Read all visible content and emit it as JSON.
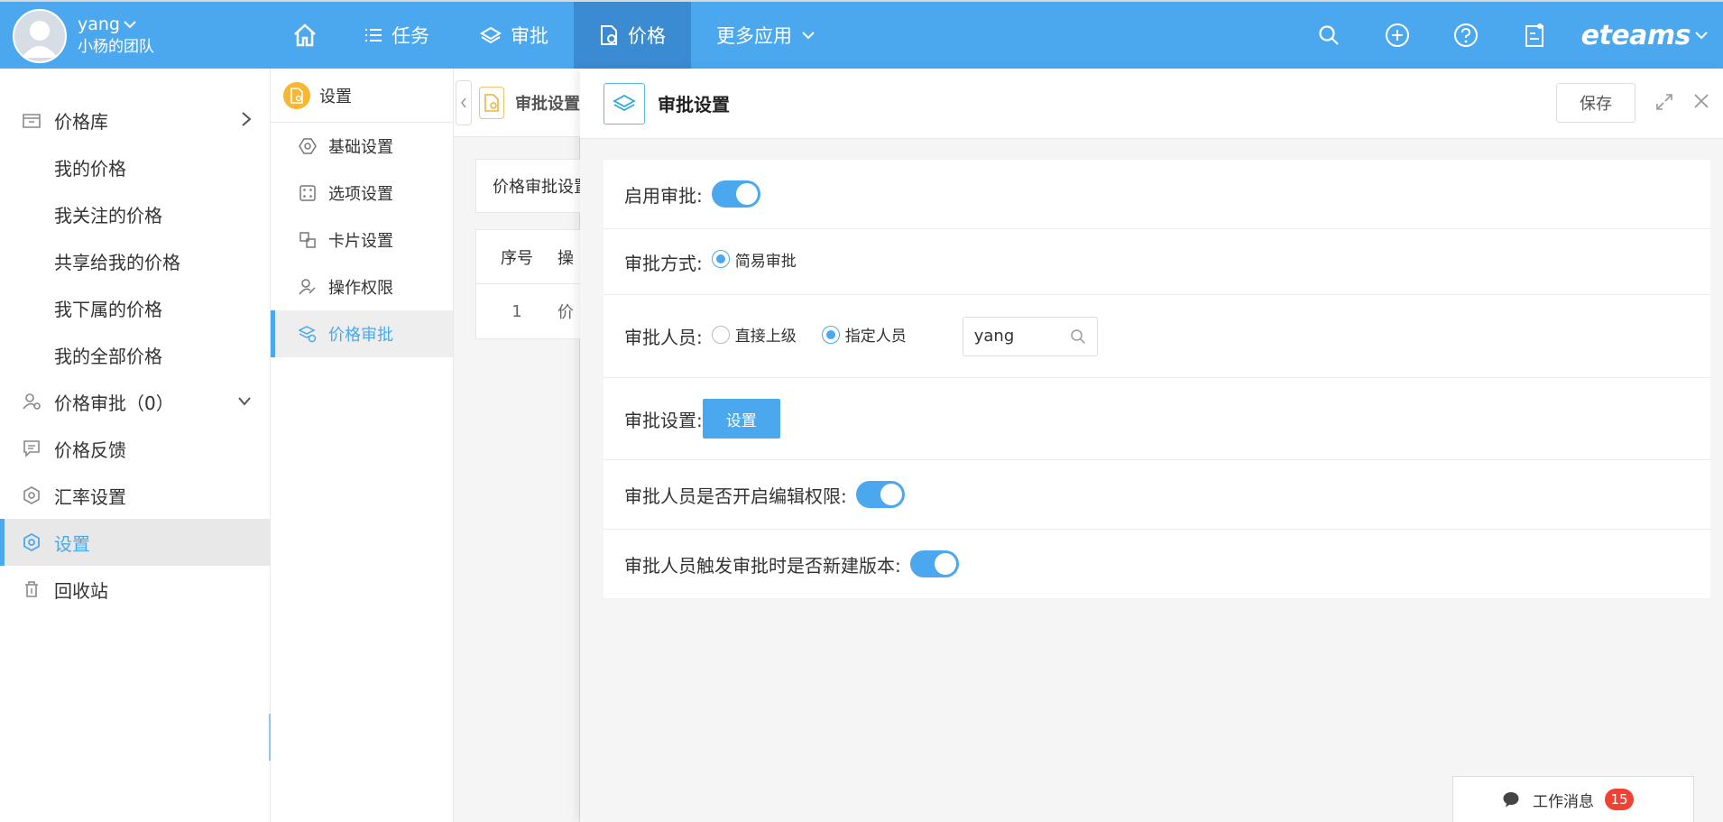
{
  "user": {
    "name": "yang",
    "team": "小杨的团队"
  },
  "nav": {
    "items": [
      {
        "label": "任务"
      },
      {
        "label": "审批"
      },
      {
        "label": "价格"
      },
      {
        "label": "更多应用"
      }
    ]
  },
  "brand": "eteams",
  "sidebar": {
    "items": [
      {
        "label": "价格库"
      },
      {
        "label": "我的价格"
      },
      {
        "label": "我关注的价格"
      },
      {
        "label": "共享给我的价格"
      },
      {
        "label": "我下属的价格"
      },
      {
        "label": "我的全部价格"
      },
      {
        "label": "价格审批（0）"
      },
      {
        "label": "价格反馈"
      },
      {
        "label": "汇率设置"
      },
      {
        "label": "设置"
      },
      {
        "label": "回收站"
      }
    ]
  },
  "settings_panel": {
    "title": "设置",
    "items": [
      {
        "label": "基础设置"
      },
      {
        "label": "选项设置"
      },
      {
        "label": "卡片设置"
      },
      {
        "label": "操作权限"
      },
      {
        "label": "价格审批"
      }
    ]
  },
  "background_page": {
    "tab_title": "审批设置",
    "section_label": "价格审批设置",
    "table": {
      "col_index": "序号",
      "col_second": "操",
      "row_index": "1",
      "row_second": "价"
    }
  },
  "drawer": {
    "title": "审批设置",
    "save_label": "保存",
    "rows": {
      "enable_label": "启用审批:",
      "mode_label": "审批方式:",
      "mode_option": "简易审批",
      "approver_label": "审批人员:",
      "approver_option_direct": "直接上级",
      "approver_option_specified": "指定人员",
      "approver_value": "yang",
      "settings_label": "审批设置:",
      "settings_button": "设置",
      "edit_permission_label": "审批人员是否开启编辑权限:",
      "new_version_label": "审批人员触发审批时是否新建版本:"
    }
  },
  "messages": {
    "label": "工作消息",
    "count": "15"
  },
  "colors": {
    "primary": "#4ba8ee",
    "nav_active": "#3a8bd2",
    "badge": "#f04134"
  }
}
